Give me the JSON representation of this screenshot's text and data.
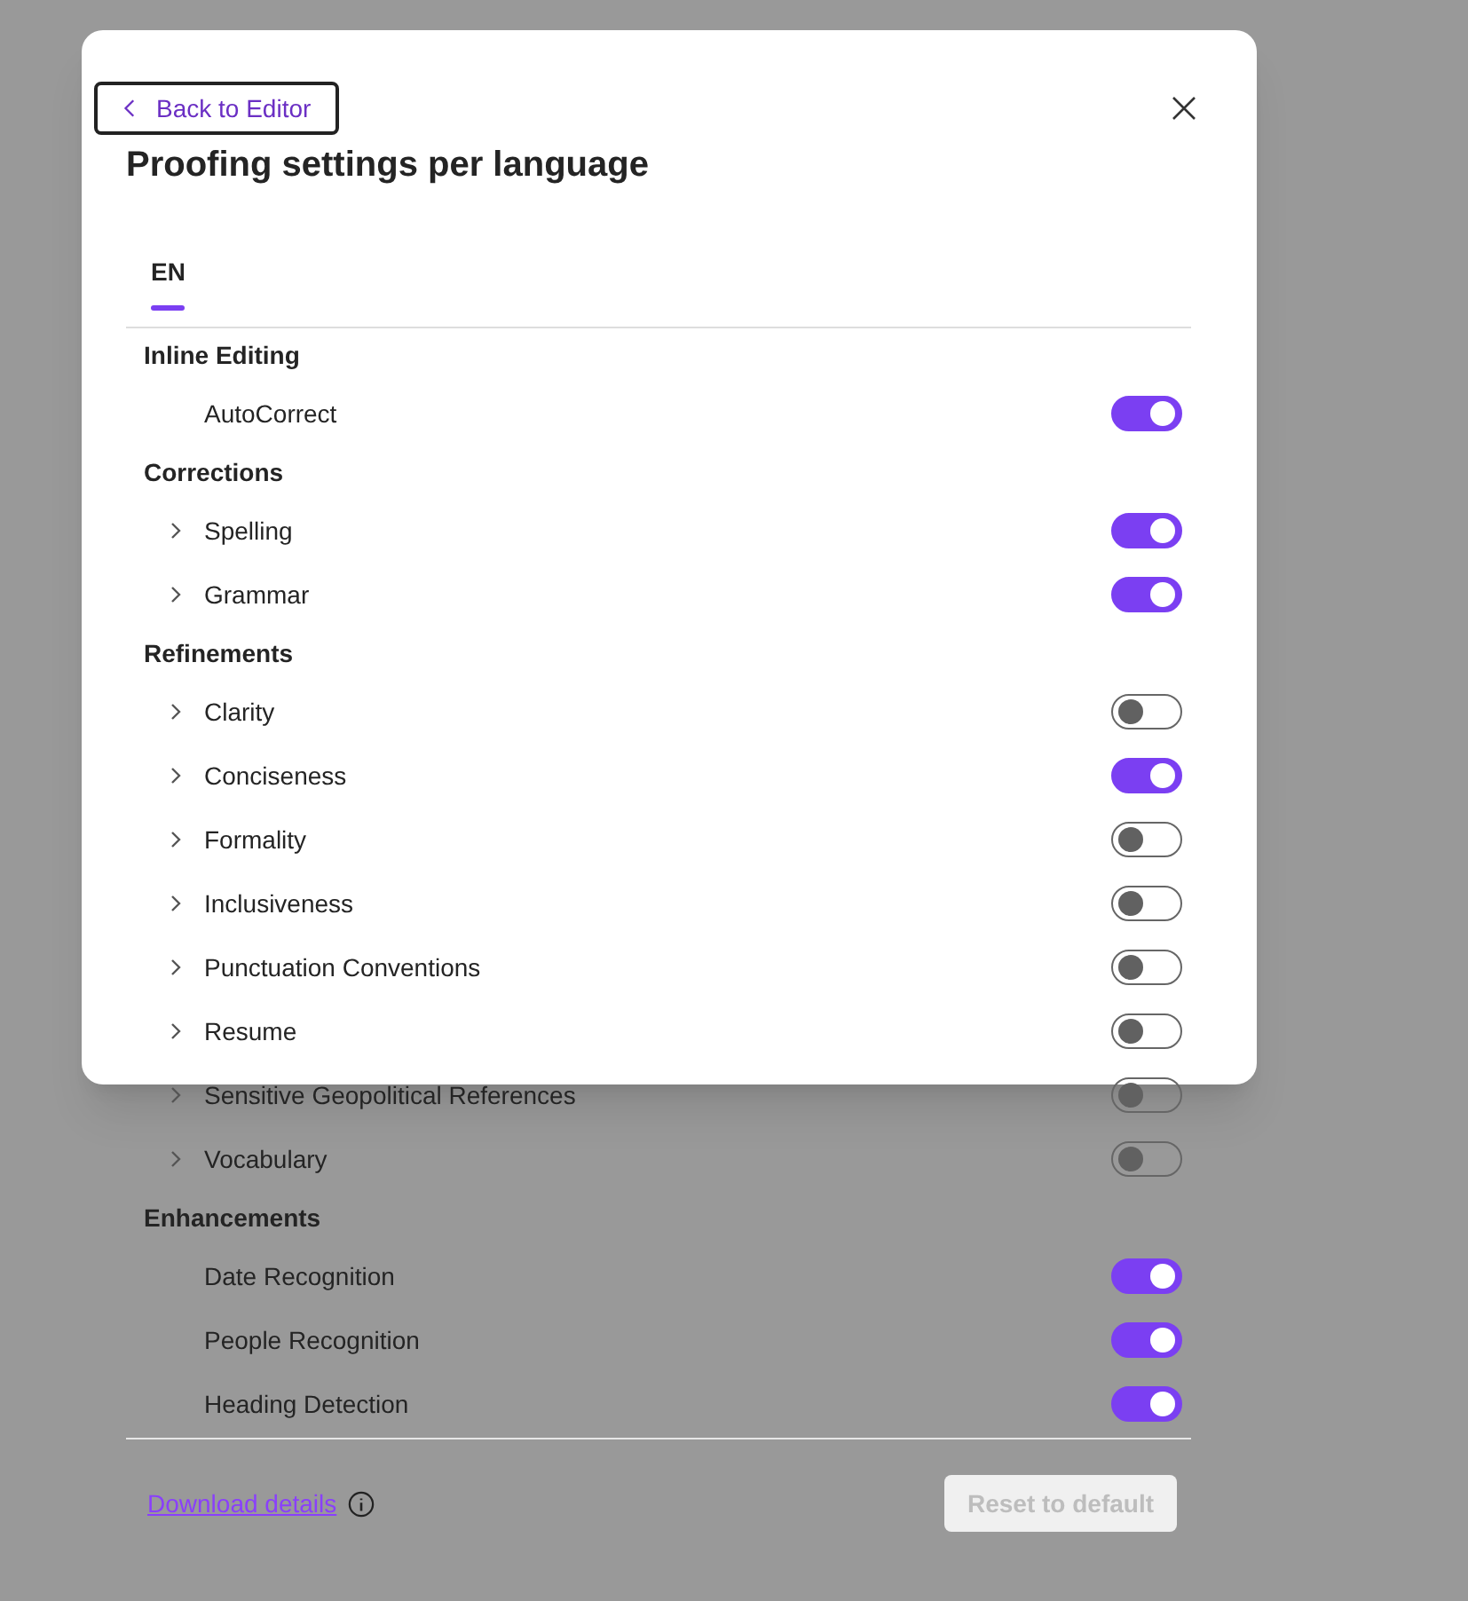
{
  "back_button": {
    "label": "Back to Editor"
  },
  "title": "Proofing settings per language",
  "tabs": [
    {
      "label": "EN",
      "selected": true
    }
  ],
  "sections": [
    {
      "heading": "Inline Editing",
      "items": [
        {
          "label": "AutoCorrect",
          "expandable": false,
          "on": true
        }
      ]
    },
    {
      "heading": "Corrections",
      "items": [
        {
          "label": "Spelling",
          "expandable": true,
          "on": true
        },
        {
          "label": "Grammar",
          "expandable": true,
          "on": true
        }
      ]
    },
    {
      "heading": "Refinements",
      "items": [
        {
          "label": "Clarity",
          "expandable": true,
          "on": false
        },
        {
          "label": "Conciseness",
          "expandable": true,
          "on": true
        },
        {
          "label": "Formality",
          "expandable": true,
          "on": false
        },
        {
          "label": "Inclusiveness",
          "expandable": true,
          "on": false
        },
        {
          "label": "Punctuation Conventions",
          "expandable": true,
          "on": false
        },
        {
          "label": "Resume",
          "expandable": true,
          "on": false
        },
        {
          "label": "Sensitive Geopolitical References",
          "expandable": true,
          "on": false
        },
        {
          "label": "Vocabulary",
          "expandable": true,
          "on": false
        }
      ]
    },
    {
      "heading": "Enhancements",
      "items": [
        {
          "label": "Date Recognition",
          "expandable": false,
          "on": true
        },
        {
          "label": "People Recognition",
          "expandable": false,
          "on": true
        },
        {
          "label": "Heading Detection",
          "expandable": false,
          "on": true
        }
      ]
    }
  ],
  "footer": {
    "link": "Download details",
    "reset_button": {
      "label": "Reset to default",
      "disabled": true
    }
  }
}
